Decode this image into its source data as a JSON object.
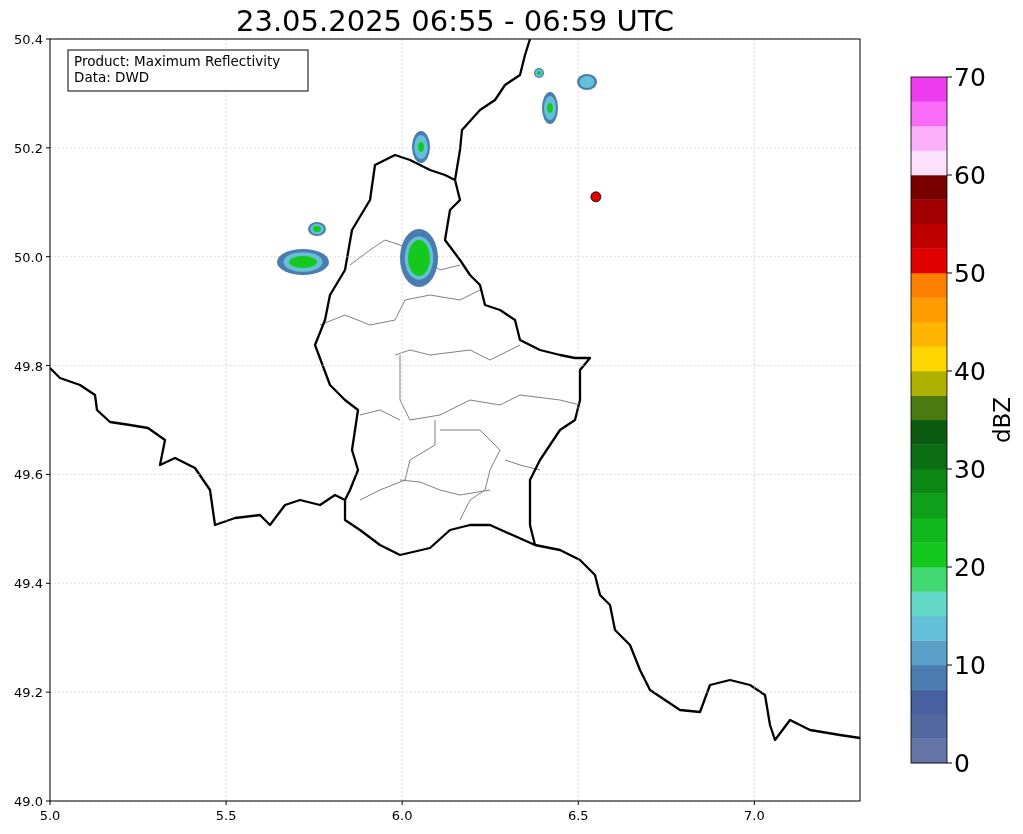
{
  "map": {
    "chart_data": {
      "type": "scatter",
      "title": "23.05.2025 06:55 - 06:59 UTC",
      "grid": true,
      "xlim": [
        5,
        7.3
      ],
      "ylim": [
        49,
        50.4
      ],
      "xticks": [
        {
          "value": 5,
          "label": "5.0"
        },
        {
          "value": 5.5,
          "label": "5.5"
        },
        {
          "value": 6,
          "label": "6.0"
        },
        {
          "value": 6.5,
          "label": "6.5"
        },
        {
          "value": 7,
          "label": "7.0"
        }
      ],
      "yticks": [
        {
          "value": 49,
          "label": "49.0"
        },
        {
          "value": 49.2,
          "label": "49.2"
        },
        {
          "value": 49.4,
          "label": "49.4"
        },
        {
          "value": 49.6,
          "label": "49.6"
        },
        {
          "value": 49.8,
          "label": "49.8"
        },
        {
          "value": 50,
          "label": "50.0"
        },
        {
          "value": 50.2,
          "label": "50.2"
        },
        {
          "value": 50.4,
          "label": "50.4"
        }
      ],
      "x": [
        6.55
      ],
      "series": [
        {
          "color": "#e00000",
          "values": [
            50.11
          ]
        }
      ]
    }
  },
  "info_box": {
    "lines": [
      "Product: Maximum Reflectivity",
      "Data: DWD"
    ]
  },
  "colorbar": {
    "label": "dBZ",
    "ticks": [
      "70",
      "60",
      "50",
      "40",
      "30",
      "20",
      "10",
      "0"
    ],
    "bins": [
      {
        "color": "#6474a4"
      },
      {
        "color": "#5468a0"
      },
      {
        "color": "#4660a0"
      },
      {
        "color": "#4a7cb0"
      },
      {
        "color": "#5aa0c8"
      },
      {
        "color": "#64c0d8"
      },
      {
        "color": "#64d8c8"
      },
      {
        "color": "#40d870"
      },
      {
        "color": "#14c81e"
      },
      {
        "color": "#10b81e"
      },
      {
        "color": "#0ea01a"
      },
      {
        "color": "#0e8814"
      },
      {
        "color": "#0c6e14"
      },
      {
        "color": "#0a5a10"
      },
      {
        "color": "#4a7a10"
      },
      {
        "color": "#b0b000"
      },
      {
        "color": "#ffd700"
      },
      {
        "color": "#ffb400"
      },
      {
        "color": "#ff9c00"
      },
      {
        "color": "#ff8000"
      },
      {
        "color": "#e00000"
      },
      {
        "color": "#c00000"
      },
      {
        "color": "#a00000"
      },
      {
        "color": "#7a0000"
      },
      {
        "color": "#fde0fc"
      },
      {
        "color": "#fcb0fc"
      },
      {
        "color": "#f86cf8"
      },
      {
        "color": "#f03cf0"
      }
    ]
  }
}
